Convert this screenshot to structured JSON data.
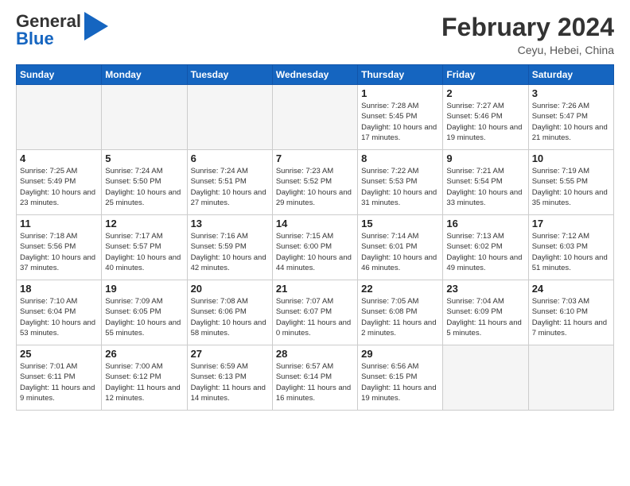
{
  "header": {
    "logo_general": "General",
    "logo_blue": "Blue",
    "month_year": "February 2024",
    "location": "Ceyu, Hebei, China"
  },
  "weekdays": [
    "Sunday",
    "Monday",
    "Tuesday",
    "Wednesday",
    "Thursday",
    "Friday",
    "Saturday"
  ],
  "weeks": [
    [
      {
        "day": "",
        "empty": true
      },
      {
        "day": "",
        "empty": true
      },
      {
        "day": "",
        "empty": true
      },
      {
        "day": "",
        "empty": true
      },
      {
        "day": "1",
        "info": "Sunrise: 7:28 AM\nSunset: 5:45 PM\nDaylight: 10 hours\nand 17 minutes."
      },
      {
        "day": "2",
        "info": "Sunrise: 7:27 AM\nSunset: 5:46 PM\nDaylight: 10 hours\nand 19 minutes."
      },
      {
        "day": "3",
        "info": "Sunrise: 7:26 AM\nSunset: 5:47 PM\nDaylight: 10 hours\nand 21 minutes."
      }
    ],
    [
      {
        "day": "4",
        "info": "Sunrise: 7:25 AM\nSunset: 5:49 PM\nDaylight: 10 hours\nand 23 minutes."
      },
      {
        "day": "5",
        "info": "Sunrise: 7:24 AM\nSunset: 5:50 PM\nDaylight: 10 hours\nand 25 minutes."
      },
      {
        "day": "6",
        "info": "Sunrise: 7:24 AM\nSunset: 5:51 PM\nDaylight: 10 hours\nand 27 minutes."
      },
      {
        "day": "7",
        "info": "Sunrise: 7:23 AM\nSunset: 5:52 PM\nDaylight: 10 hours\nand 29 minutes."
      },
      {
        "day": "8",
        "info": "Sunrise: 7:22 AM\nSunset: 5:53 PM\nDaylight: 10 hours\nand 31 minutes."
      },
      {
        "day": "9",
        "info": "Sunrise: 7:21 AM\nSunset: 5:54 PM\nDaylight: 10 hours\nand 33 minutes."
      },
      {
        "day": "10",
        "info": "Sunrise: 7:19 AM\nSunset: 5:55 PM\nDaylight: 10 hours\nand 35 minutes."
      }
    ],
    [
      {
        "day": "11",
        "info": "Sunrise: 7:18 AM\nSunset: 5:56 PM\nDaylight: 10 hours\nand 37 minutes."
      },
      {
        "day": "12",
        "info": "Sunrise: 7:17 AM\nSunset: 5:57 PM\nDaylight: 10 hours\nand 40 minutes."
      },
      {
        "day": "13",
        "info": "Sunrise: 7:16 AM\nSunset: 5:59 PM\nDaylight: 10 hours\nand 42 minutes."
      },
      {
        "day": "14",
        "info": "Sunrise: 7:15 AM\nSunset: 6:00 PM\nDaylight: 10 hours\nand 44 minutes."
      },
      {
        "day": "15",
        "info": "Sunrise: 7:14 AM\nSunset: 6:01 PM\nDaylight: 10 hours\nand 46 minutes."
      },
      {
        "day": "16",
        "info": "Sunrise: 7:13 AM\nSunset: 6:02 PM\nDaylight: 10 hours\nand 49 minutes."
      },
      {
        "day": "17",
        "info": "Sunrise: 7:12 AM\nSunset: 6:03 PM\nDaylight: 10 hours\nand 51 minutes."
      }
    ],
    [
      {
        "day": "18",
        "info": "Sunrise: 7:10 AM\nSunset: 6:04 PM\nDaylight: 10 hours\nand 53 minutes."
      },
      {
        "day": "19",
        "info": "Sunrise: 7:09 AM\nSunset: 6:05 PM\nDaylight: 10 hours\nand 55 minutes."
      },
      {
        "day": "20",
        "info": "Sunrise: 7:08 AM\nSunset: 6:06 PM\nDaylight: 10 hours\nand 58 minutes."
      },
      {
        "day": "21",
        "info": "Sunrise: 7:07 AM\nSunset: 6:07 PM\nDaylight: 11 hours\nand 0 minutes."
      },
      {
        "day": "22",
        "info": "Sunrise: 7:05 AM\nSunset: 6:08 PM\nDaylight: 11 hours\nand 2 minutes."
      },
      {
        "day": "23",
        "info": "Sunrise: 7:04 AM\nSunset: 6:09 PM\nDaylight: 11 hours\nand 5 minutes."
      },
      {
        "day": "24",
        "info": "Sunrise: 7:03 AM\nSunset: 6:10 PM\nDaylight: 11 hours\nand 7 minutes."
      }
    ],
    [
      {
        "day": "25",
        "info": "Sunrise: 7:01 AM\nSunset: 6:11 PM\nDaylight: 11 hours\nand 9 minutes."
      },
      {
        "day": "26",
        "info": "Sunrise: 7:00 AM\nSunset: 6:12 PM\nDaylight: 11 hours\nand 12 minutes."
      },
      {
        "day": "27",
        "info": "Sunrise: 6:59 AM\nSunset: 6:13 PM\nDaylight: 11 hours\nand 14 minutes."
      },
      {
        "day": "28",
        "info": "Sunrise: 6:57 AM\nSunset: 6:14 PM\nDaylight: 11 hours\nand 16 minutes."
      },
      {
        "day": "29",
        "info": "Sunrise: 6:56 AM\nSunset: 6:15 PM\nDaylight: 11 hours\nand 19 minutes."
      },
      {
        "day": "",
        "empty": true
      },
      {
        "day": "",
        "empty": true
      }
    ]
  ]
}
